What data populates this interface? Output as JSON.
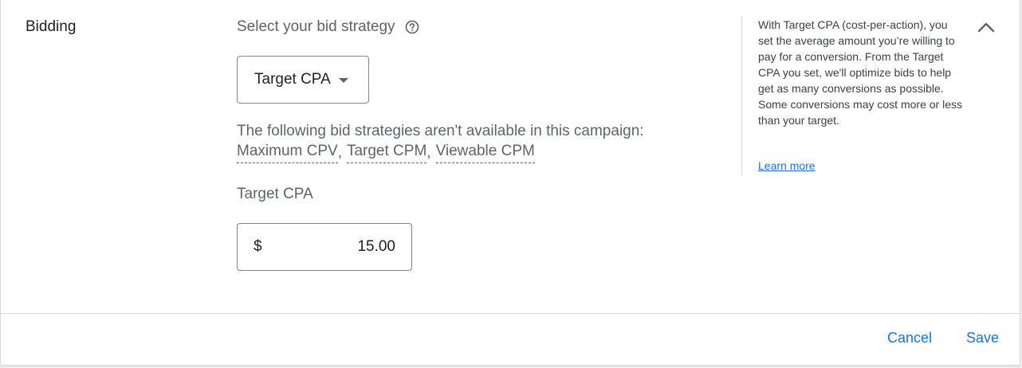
{
  "section": {
    "title": "Bidding"
  },
  "strategy": {
    "prompt": "Select your bid strategy",
    "selected": "Target CPA",
    "unavailable_intro": "The following bid strategies aren't available in this campaign:",
    "unavailable_items": [
      "Maximum CPV",
      "Target CPM",
      "Viewable CPM"
    ]
  },
  "target_cpa": {
    "label": "Target CPA",
    "currency": "$",
    "value": "15.00"
  },
  "help": {
    "text": "With Target CPA (cost-per-action), you set the average amount you’re willing to pay for a conversion. From the Target CPA you set, we'll optimize bids to help get as many conversions as possible. Some conversions may cost more or less than your target.",
    "link": "Learn more"
  },
  "footer": {
    "cancel": "Cancel",
    "save": "Save"
  },
  "colors": {
    "accent": "#1a73e8",
    "text": "#3c4043",
    "muted": "#5f6368",
    "border": "#dadce0"
  },
  "icons": {
    "help": "help-circle-icon",
    "caret": "caret-down-icon",
    "collapse": "chevron-up-icon"
  }
}
